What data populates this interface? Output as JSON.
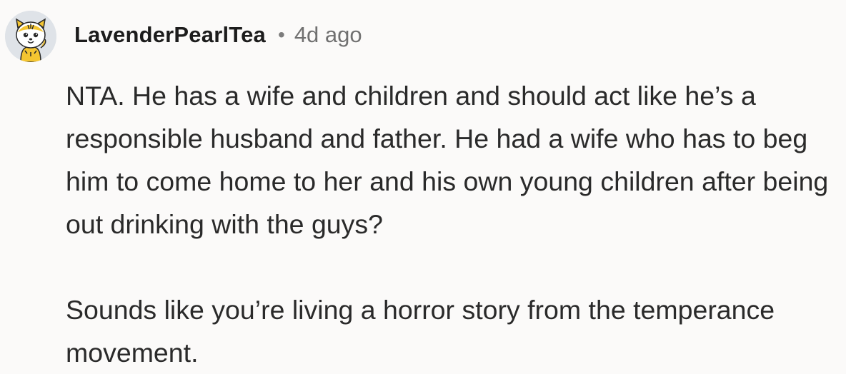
{
  "comment": {
    "username": "LavenderPearlTea",
    "separator": "•",
    "timestamp": "4d ago",
    "avatar_icon": "tiger-mascot-icon",
    "paragraphs": [
      "NTA. He has a wife and children and should act like he’s a responsible husband and father. He had a wife who has to beg him to come home to her and his own young children after being out drinking with the guys?",
      "Sounds like you’re living a horror story from the temperance movement."
    ]
  },
  "colors": {
    "background": "#fbfaf9",
    "username": "#1c1c1c",
    "meta": "#707070",
    "body_text": "#2a2a2a",
    "avatar_bg": "#dfe3e8",
    "avatar_accent": "#f4c531"
  }
}
